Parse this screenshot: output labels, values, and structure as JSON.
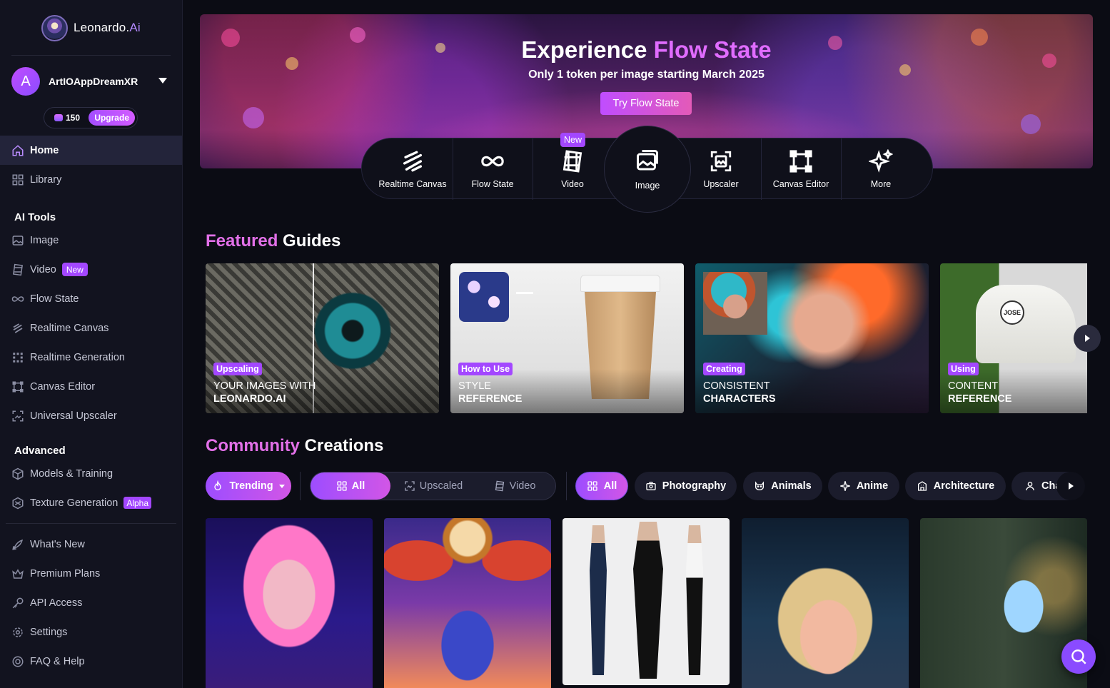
{
  "brand": {
    "name": "Leonardo.",
    "suffix": "Ai"
  },
  "user": {
    "initial": "A",
    "name": "ArtIOAppDreamXR",
    "tokens": "150",
    "upgrade_label": "Upgrade"
  },
  "sidebar": {
    "primary": [
      {
        "label": "Home",
        "icon": "home-icon",
        "active": true
      },
      {
        "label": "Library",
        "icon": "grid-icon"
      }
    ],
    "ai_tools_heading": "AI Tools",
    "ai_tools": [
      {
        "label": "Image",
        "icon": "image-icon"
      },
      {
        "label": "Video",
        "icon": "film-icon",
        "badge": "New"
      },
      {
        "label": "Flow State",
        "icon": "infinity-icon"
      },
      {
        "label": "Realtime Canvas",
        "icon": "brush-icon"
      },
      {
        "label": "Realtime Generation",
        "icon": "dots-icon"
      },
      {
        "label": "Canvas Editor",
        "icon": "canvas-icon"
      },
      {
        "label": "Universal Upscaler",
        "icon": "upscale-icon"
      }
    ],
    "advanced_heading": "Advanced",
    "advanced": [
      {
        "label": "Models & Training",
        "icon": "cube-icon"
      },
      {
        "label": "Texture Generation",
        "icon": "texture-icon",
        "badge": "Alpha"
      }
    ],
    "footer": [
      {
        "label": "What's New",
        "icon": "rocket-icon"
      },
      {
        "label": "Premium Plans",
        "icon": "crown-icon"
      },
      {
        "label": "API Access",
        "icon": "key-icon"
      },
      {
        "label": "Settings",
        "icon": "gear-icon"
      },
      {
        "label": "FAQ & Help",
        "icon": "help-icon"
      }
    ]
  },
  "banner": {
    "title_plain": "Experience ",
    "title_accent": "Flow State",
    "subtitle": "Only 1 token per image starting March 2025",
    "cta": "Try Flow State"
  },
  "tools": [
    {
      "label": "Realtime Canvas",
      "icon": "realtime-canvas-icon"
    },
    {
      "label": "Flow State",
      "icon": "infinity-icon"
    },
    {
      "label": "Video",
      "icon": "film-icon",
      "badge": "New"
    },
    {
      "label": "Image",
      "icon": "image-icon",
      "selected": true
    },
    {
      "label": "Upscaler",
      "icon": "upscale-icon"
    },
    {
      "label": "Canvas Editor",
      "icon": "canvas-icon"
    },
    {
      "label": "More",
      "icon": "sparkles-icon"
    }
  ],
  "featured": {
    "title_accent": "Featured",
    "title_plain": " Guides",
    "guides": [
      {
        "tag": "Upscaling",
        "line1": "YOUR IMAGES WITH",
        "line2": "LEONARDO.AI"
      },
      {
        "tag": "How to Use",
        "line1": "STYLE",
        "line2": "REFERENCE"
      },
      {
        "tag": "Creating",
        "line1": "CONSISTENT",
        "line2": "CHARACTERS"
      },
      {
        "tag": "Using",
        "line1": "CONTENT",
        "line2": "REFERENCE"
      }
    ],
    "shoe_label": "JOSE"
  },
  "community": {
    "title_accent": "Community",
    "title_plain": " Creations",
    "sort": "Trending",
    "type_filters": [
      "All",
      "Upscaled",
      "Video"
    ],
    "categories": [
      "All",
      "Photography",
      "Animals",
      "Anime",
      "Architecture",
      "Cha"
    ]
  },
  "colors": {
    "accent": "#a347ff",
    "accent_pink": "#e270e8",
    "bg": "#0b0c14",
    "sidebar": "#12131f"
  }
}
